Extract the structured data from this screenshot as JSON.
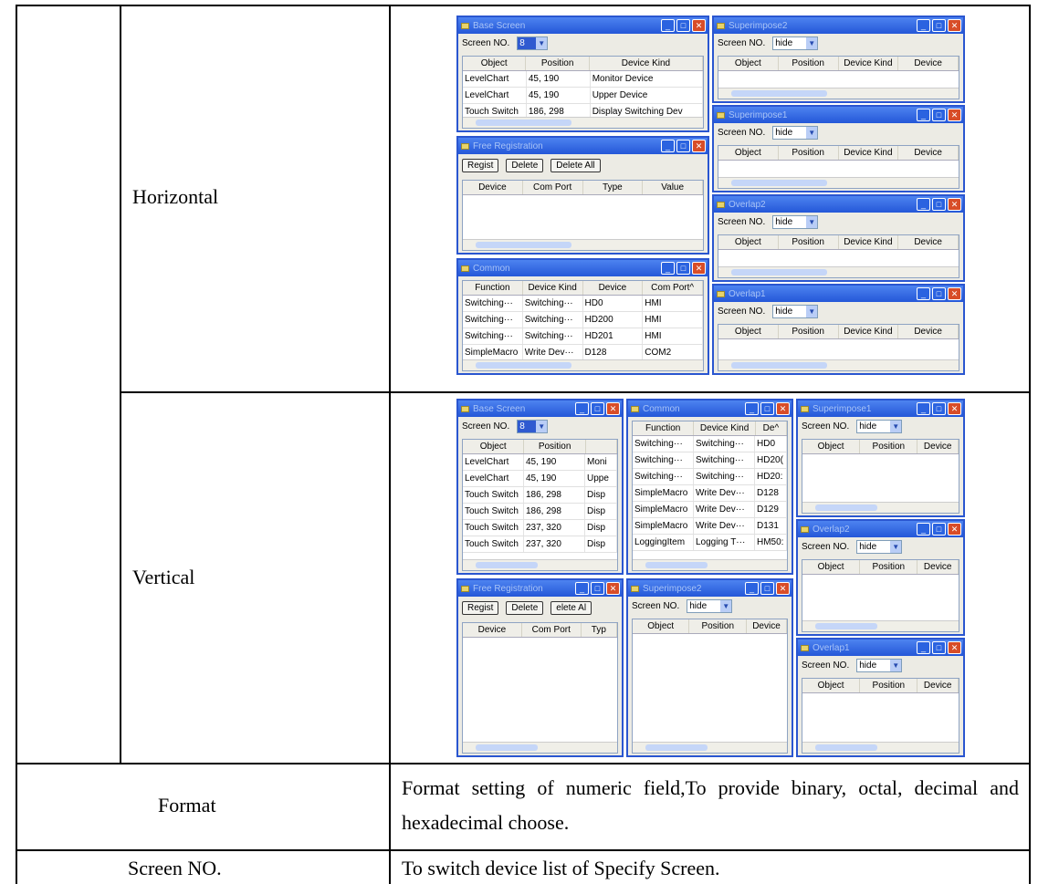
{
  "rows": {
    "horizontal_label": "Horizontal",
    "vertical_label": "Vertical",
    "format_label": "Format",
    "format_desc": "Format setting of numeric field,To provide binary, octal, decimal and hexadecimal choose.",
    "screen_no_label": "Screen NO.",
    "screen_no_desc": "To switch device list of Specify Screen."
  },
  "ui": {
    "titles": {
      "base": "Base Screen",
      "free": "Free Registration",
      "common": "Common",
      "superimpose1": "Superimpose1",
      "superimpose2": "Superimpose2",
      "overlap1": "Overlap1",
      "overlap2": "Overlap2"
    },
    "screen_no_caption": "Screen NO.",
    "screen_value_base": "8",
    "screen_value_hide": "hide",
    "buttons": {
      "regist": "Regist",
      "delete": "Delete",
      "delete_all": "Delete All",
      "delete_all_cut": "elete Al"
    },
    "cols": {
      "object": "Object",
      "position": "Position",
      "device_kind": "Device Kind",
      "device": "Device",
      "com_port": "Com Port",
      "type": "Type",
      "type_cut": "Typ",
      "value": "Value",
      "function": "Function",
      "com_port_cut": "Com Port^",
      "de_cut": "De^"
    },
    "base_rows_h": [
      [
        "LevelChart",
        "45, 190",
        "Monitor Device"
      ],
      [
        "LevelChart",
        "45, 190",
        "Upper Device"
      ],
      [
        "Touch Switch",
        "186, 298",
        "Display Switching Dev"
      ]
    ],
    "common_rows_h": [
      [
        "Switching···",
        "Switching···",
        "HD0",
        "HMI"
      ],
      [
        "Switching···",
        "Switching···",
        "HD200",
        "HMI"
      ],
      [
        "Switching···",
        "Switching···",
        "HD201",
        "HMI"
      ],
      [
        "SimpleMacro",
        "Write Dev···",
        "D128",
        "COM2"
      ]
    ],
    "base_rows_v": [
      [
        "LevelChart",
        "45, 190",
        "Moni"
      ],
      [
        "LevelChart",
        "45, 190",
        "Uppe"
      ],
      [
        "Touch Switch",
        "186, 298",
        "Disp"
      ],
      [
        "Touch Switch",
        "186, 298",
        "Disp"
      ],
      [
        "Touch Switch",
        "237, 320",
        "Disp"
      ],
      [
        "Touch Switch",
        "237, 320",
        "Disp"
      ]
    ],
    "common_rows_v": [
      [
        "Switching···",
        "Switching···",
        "HD0"
      ],
      [
        "Switching···",
        "Switching···",
        "HD20("
      ],
      [
        "Switching···",
        "Switching···",
        "HD20:"
      ],
      [
        "SimpleMacro",
        "Write Dev···",
        "D128"
      ],
      [
        "SimpleMacro",
        "Write Dev···",
        "D129"
      ],
      [
        "SimpleMacro",
        "Write Dev···",
        "D131"
      ],
      [
        "LoggingItem",
        "Logging T···",
        "HM50:"
      ]
    ]
  }
}
